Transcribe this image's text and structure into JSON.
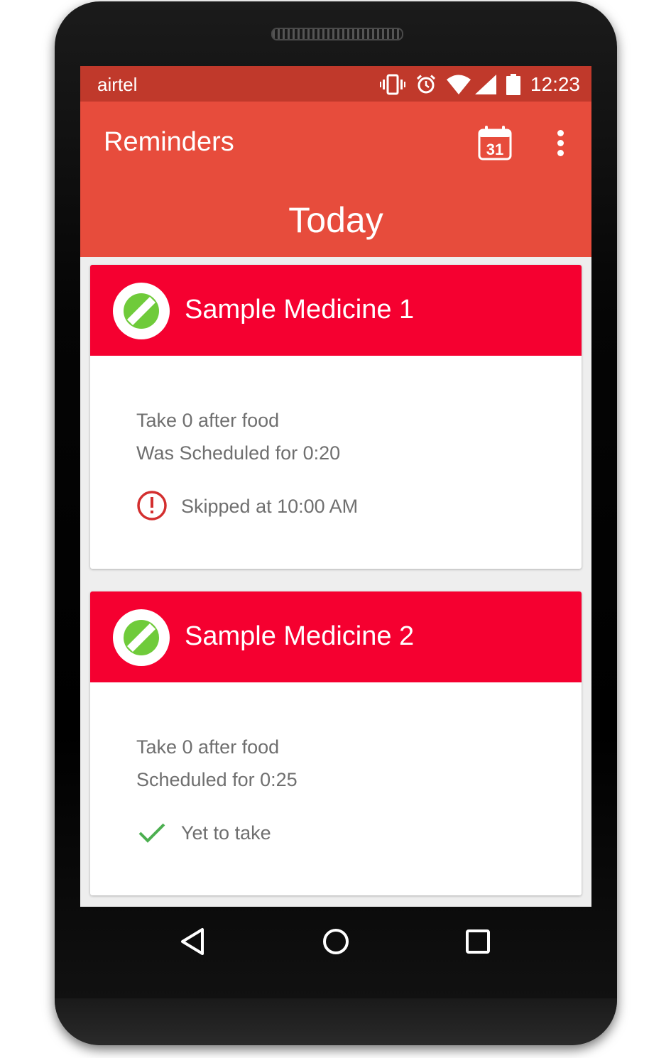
{
  "status_bar": {
    "carrier": "airtel",
    "time": "12:23",
    "icons": [
      "vibrate-icon",
      "alarm-icon",
      "wifi-icon",
      "signal-icon",
      "battery-icon"
    ]
  },
  "app_bar": {
    "title": "Reminders",
    "calendar_day": "31",
    "day_title": "Today"
  },
  "reminders": [
    {
      "name": "Sample Medicine 1",
      "instruction": "Take 0 after food",
      "schedule": "Was Scheduled for 0:20",
      "status": "Skipped at 10:00 AM",
      "status_icon": "alert-circle-icon"
    },
    {
      "name": "Sample Medicine 2",
      "instruction": "Take 0 after food",
      "schedule": "Scheduled for 0:25",
      "status": "Yet to take",
      "status_icon": "check-icon"
    }
  ],
  "colors": {
    "status_bar": "#c0392b",
    "app_bar": "#e74c3c",
    "card_header": "#f50030",
    "pill": "#6fcb3a",
    "skipped": "#d32f2f",
    "check": "#4caf50"
  },
  "nav_bar": [
    "back-icon",
    "home-icon",
    "recents-icon"
  ]
}
